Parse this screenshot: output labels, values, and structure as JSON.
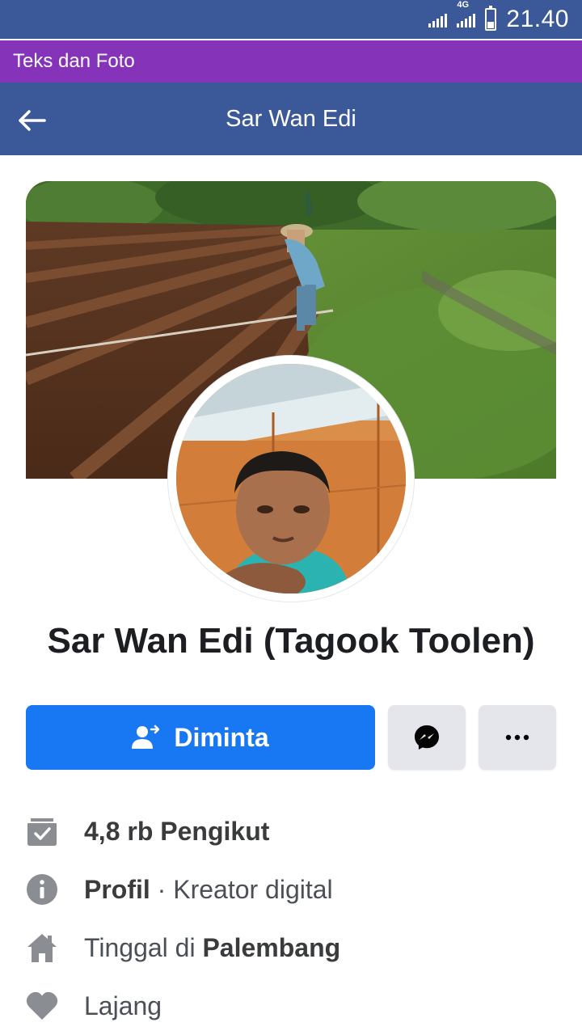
{
  "status_bar": {
    "network_label": "4G",
    "clock": "21.40"
  },
  "banner": {
    "text": "Teks dan Foto"
  },
  "app_bar": {
    "title": "Sar Wan Edi",
    "back_icon": "arrow-left-icon"
  },
  "profile": {
    "name": "Sar Wan Edi (Tagook Toolen)"
  },
  "actions": {
    "primary_label": "Diminta",
    "primary_icon": "person-requested-icon",
    "messenger_icon": "messenger-icon",
    "more_icon": "more-dots-icon"
  },
  "info": {
    "followers_bold": "4,8 rb Pengikut",
    "profile_bold": "Profil",
    "profile_rest": " · Kreator digital",
    "lives_prefix": "Tinggal di ",
    "lives_city": "Palembang",
    "relationship": "Lajang"
  },
  "colors": {
    "status_bar": "#3b5998",
    "banner": "#8533b8",
    "primary_button": "#1877f2",
    "icon_gray": "#8a8d91"
  }
}
